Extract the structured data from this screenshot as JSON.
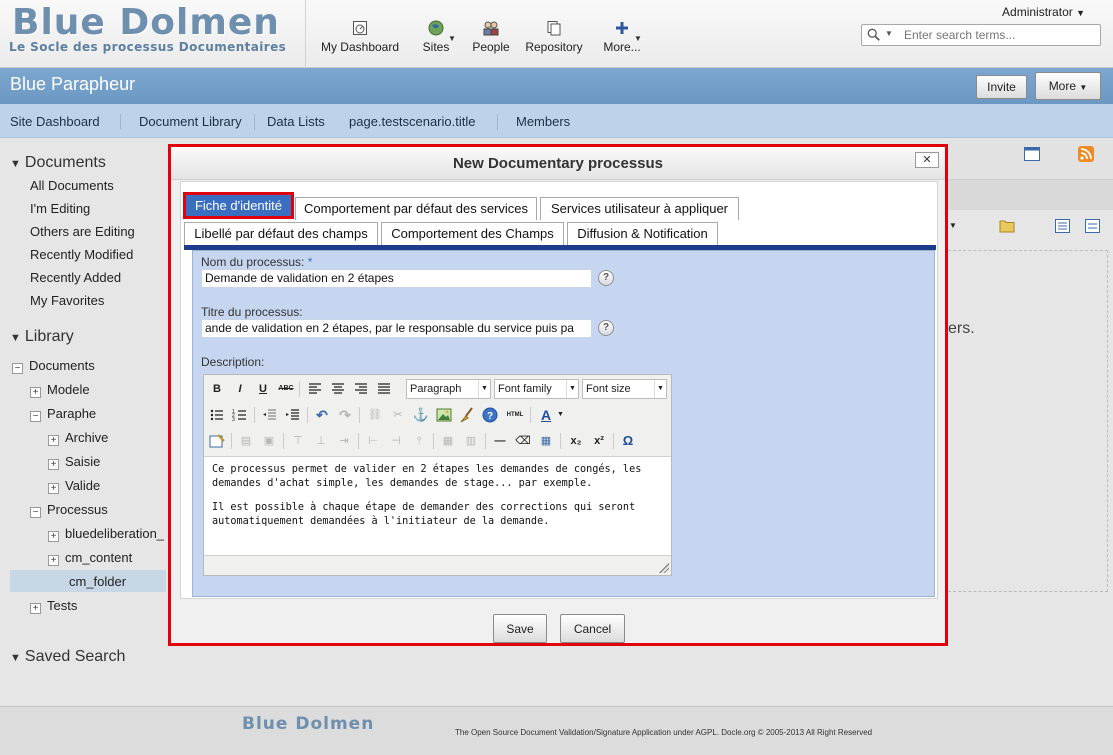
{
  "header": {
    "logo_title": "Blue Dolmen",
    "logo_subtitle": "Le Socle des processus Documentaires",
    "nav": {
      "my_dashboard": "My Dashboard",
      "sites": "Sites",
      "people": "People",
      "repository": "Repository",
      "more": "More..."
    },
    "user": "Administrator",
    "search_placeholder": "Enter search terms..."
  },
  "site": {
    "title": "Blue Parapheur",
    "invite_label": "Invite",
    "more_label": "More"
  },
  "site_nav": [
    "Site Dashboard",
    "Document Library",
    "Data Lists",
    "page.testscenario.title",
    "Members"
  ],
  "left_panel": {
    "documents_header": "Documents",
    "filters": [
      "All Documents",
      "I'm Editing",
      "Others are Editing",
      "Recently Modified",
      "Recently Added",
      "My Favorites"
    ],
    "library_header": "Library",
    "tree": {
      "root": "Documents",
      "modele": "Modele",
      "paraphe": "Paraphe",
      "archive": "Archive",
      "saisie": "Saisie",
      "valide": "Valide",
      "processus": "Processus",
      "bluedeliberation": "bluedeliberation_",
      "cm_content": "cm_content",
      "cm_folder": "cm_folder",
      "tests": "Tests"
    },
    "saved_search_header": "Saved Search"
  },
  "background_partial_text": "ers.",
  "dialog": {
    "title": "New Documentary processus",
    "close_label": "✕",
    "tabs": [
      "Fiche d'identité",
      "Comportement par défaut des services",
      "Services utilisateur à appliquer",
      "Libellé par défaut des champs",
      "Comportement des Champs",
      "Diffusion & Notification"
    ],
    "active_tab": "Fiche d'identité",
    "fields": {
      "name_label": "Nom du processus:",
      "name_required_mark": "*",
      "name_value": "Demande de validation en 2 étapes",
      "title_label": "Titre du processus:",
      "title_value": "ande de validation en 2 étapes, par le responsable du service puis pa",
      "description_label": "Description:"
    },
    "editor": {
      "format_select": "Paragraph",
      "font_family_select": "Font family",
      "font_size_select": "Font size",
      "paragraphs": [
        "Ce processus permet de valider en 2 étapes les demandes de congés, les demandes d'achat simple, les demandes de stage... par exemple.",
        "Il est possible à chaque étape de demander des corrections qui seront automatiquement demandées à l'initiateur de la demande."
      ]
    },
    "save_label": "Save",
    "cancel_label": "Cancel"
  },
  "footer": {
    "logo": "Blue Dolmen",
    "text": "The Open Source Document Validation/Signature Application under AGPL. Docle.org © 2005-2013 All Right Reserved"
  },
  "colors": {
    "brand_blue": "#6f8fae",
    "site_bar": "#7ca7cf",
    "nav_bar": "#bcd3ea",
    "highlight_red": "#e0000e",
    "active_tab": "#3a6ec0",
    "form_bg": "#c6d6f0"
  }
}
